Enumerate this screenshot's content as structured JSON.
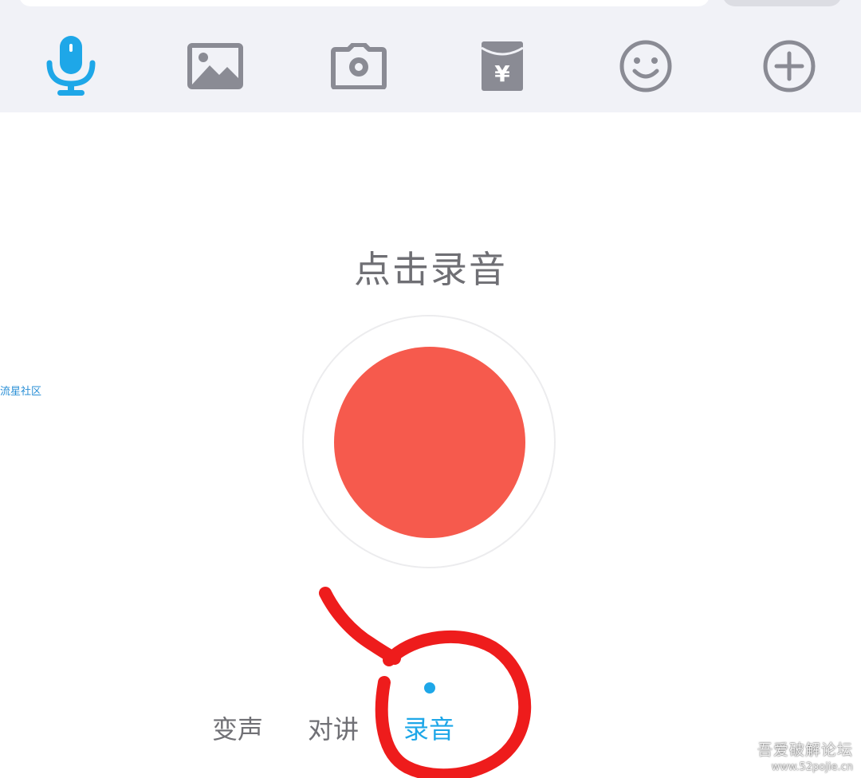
{
  "toolbar": {
    "icons": [
      {
        "name": "microphone-icon",
        "active": true
      },
      {
        "name": "image-icon",
        "active": false
      },
      {
        "name": "camera-icon",
        "active": false
      },
      {
        "name": "red-packet-icon",
        "glyph": "¥",
        "active": false
      },
      {
        "name": "emoji-icon",
        "active": false
      },
      {
        "name": "plus-icon",
        "active": false
      }
    ],
    "active_color": "#1ea7e8",
    "icon_color": "#8a8b94"
  },
  "record": {
    "title": "点击录音",
    "button_color": "#f65a4d"
  },
  "modes": {
    "tabs": [
      {
        "label": "变声",
        "active": false
      },
      {
        "label": "对讲",
        "active": false
      },
      {
        "label": "录音",
        "active": true
      }
    ]
  },
  "watermarks": {
    "left": "流星社区",
    "bottom_right_title": "吾爱破解论坛",
    "bottom_right_url": "www.52pojie.cn"
  }
}
